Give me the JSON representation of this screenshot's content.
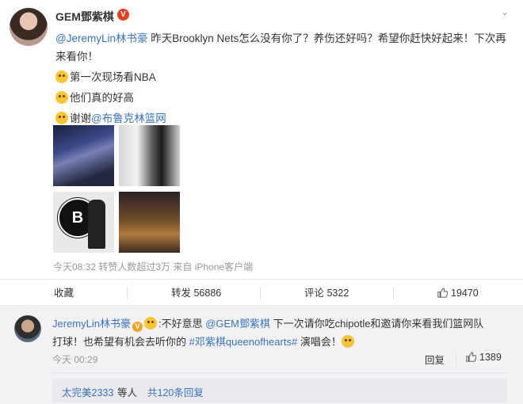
{
  "post": {
    "username": "GEM鄧紫棋",
    "badge": "V",
    "text": {
      "mention": "@JeremyLin林书豪",
      "line1_rest": " 昨天Brooklyn Nets怎么没有你了？养伤还好吗？希望你赶快好起来！下次再",
      "line2": "来看你！",
      "line3": "第一次现场看NBA",
      "line4": "他们真的好高",
      "line5_prefix": "谢谢",
      "line5_mention": "@布鲁克林篮网"
    },
    "nets_logo_letter": "B",
    "meta": "今天08:32 转赞人数超过3万 来自 iPhone客户端"
  },
  "actions": {
    "collect": "收藏",
    "repost": "转发 56886",
    "comment": "评论 5322",
    "like": "19470"
  },
  "comment": {
    "username": "JeremyLin林书豪",
    "badge": "V",
    "line1_prefix": ":不好意思 ",
    "line1_mention": "@GEM鄧紫棋",
    "line1_rest": " 下一次请你吃chipotle和邀请你来看我们篮网队",
    "line2_prefix": "打球！也希望有机会去听你的 ",
    "line2_topic": "#邓紫棋queenofhearts#",
    "line2_rest": " 演唱会！",
    "time": "今天 00:29",
    "reply": "回复",
    "like_count": "1389",
    "more_user": "太完美2333",
    "more_mid": " 等人 ",
    "more_total": "共120条回复"
  },
  "colors": {
    "link": "#3a72b8",
    "verified_red": "#e0401e",
    "verified_orange": "#f0a422",
    "meta_gray": "#999999"
  }
}
